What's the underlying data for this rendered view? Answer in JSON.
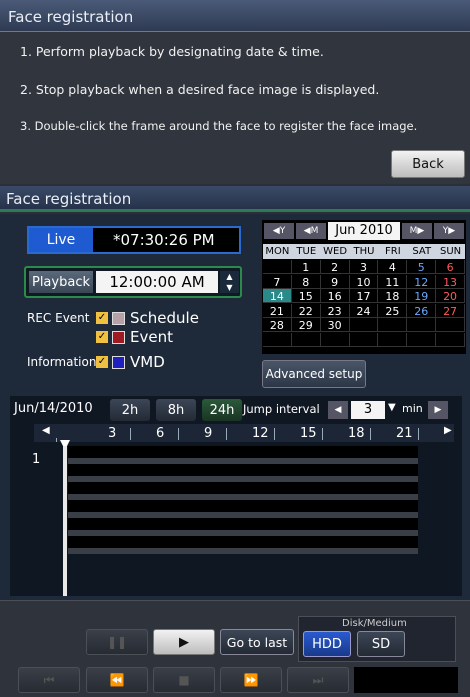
{
  "dialog": {
    "title": "Face registration",
    "steps": [
      "1. Perform playback by designating date & time.",
      "2. Stop playback when a desired face image is displayed.",
      "3. Double-click the frame around the face to register the face image."
    ],
    "back_label": "Back"
  },
  "panel": {
    "title": "Face registration",
    "live_label": "Live",
    "live_time": "*07:30:26 PM",
    "playback_label": "Playback",
    "playback_time": "12:00:00 AM",
    "rec_event_label": "REC Event",
    "schedule_label": "Schedule",
    "event_label": "Event",
    "information_label": "Information",
    "vmd_label": "VMD",
    "advanced_label": "Advanced setup"
  },
  "calendar": {
    "prev_year": "◀Y",
    "prev_month": "◀M",
    "month_label": "Jun 2010",
    "next_month": "M▶",
    "next_year": "Y▶",
    "weekdays": [
      "MON",
      "TUE",
      "WED",
      "THU",
      "FRI",
      "SAT",
      "SUN"
    ],
    "weeks": [
      [
        "",
        "1",
        "2",
        "3",
        "4",
        "5",
        "6"
      ],
      [
        "7",
        "8",
        "9",
        "10",
        "11",
        "12",
        "13"
      ],
      [
        "14",
        "15",
        "16",
        "17",
        "18",
        "19",
        "20"
      ],
      [
        "21",
        "22",
        "23",
        "24",
        "25",
        "26",
        "27"
      ],
      [
        "28",
        "29",
        "30",
        "",
        "",
        "",
        ""
      ],
      [
        "",
        "",
        "",
        "",
        "",
        "",
        ""
      ]
    ],
    "selected_day": "14"
  },
  "timeline": {
    "date": "Jun/14/2010",
    "zoom_2h": "2h",
    "zoom_8h": "8h",
    "zoom_24h": "24h",
    "jump_label": "Jump interval",
    "jump_value": "3",
    "jump_unit": "min",
    "hours": [
      "3",
      "6",
      "9",
      "12",
      "15",
      "18",
      "21"
    ],
    "camera": "1"
  },
  "controls": {
    "go_to_last": "Go to last",
    "disk_label": "Disk/Medium",
    "hdd": "HDD",
    "sd": "SD"
  }
}
